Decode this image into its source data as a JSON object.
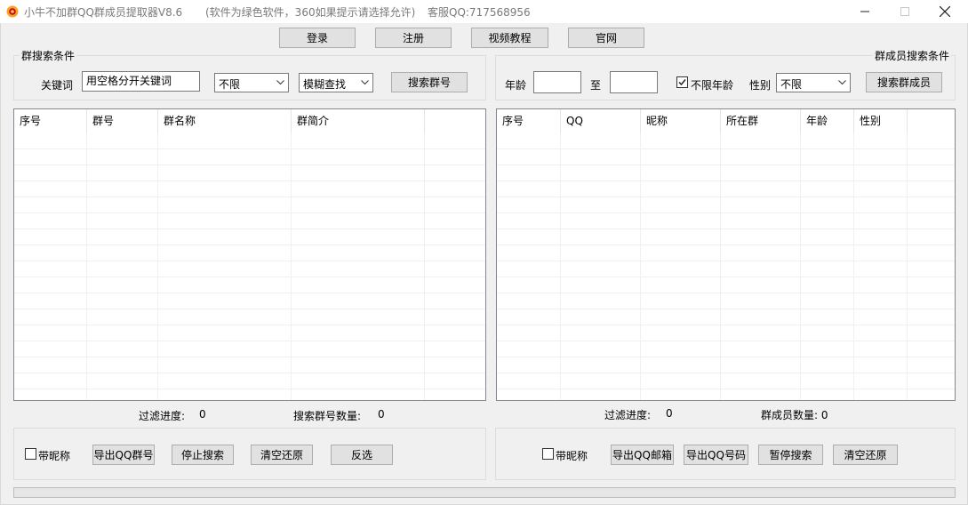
{
  "window": {
    "title": "小牛不加群QQ群成员提取器V8.6",
    "subtitle": "(软件为绿色软件，360如果提示请选择允许)",
    "service": "客服QQ:717568956"
  },
  "top_buttons": {
    "login": "登录",
    "register": "注册",
    "video": "视频教程",
    "website": "官网"
  },
  "group_search": {
    "title": "群搜索条件",
    "keyword_label": "关键词",
    "keyword_value": "用空格分开关键词",
    "filter_select": "不限",
    "match_select": "模糊查找",
    "search_button": "搜索群号"
  },
  "member_search": {
    "title": "群成员搜索条件",
    "age_label": "年龄",
    "age_from": "",
    "to_label": "至",
    "age_to": "",
    "unlimited_age_label": "不限年龄",
    "unlimited_age_checked": true,
    "gender_label": "性别",
    "gender_select": "不限",
    "search_button": "搜索群成员"
  },
  "group_table": {
    "columns": [
      "序号",
      "群号",
      "群名称",
      "群简介"
    ],
    "rows": []
  },
  "member_table": {
    "columns": [
      "序号",
      "QQ",
      "昵称",
      "所在群",
      "年龄",
      "性别"
    ],
    "rows": []
  },
  "group_status": {
    "progress_label": "过滤进度:",
    "progress_value": "0",
    "count_label": "搜索群号数量:",
    "count_value": "0"
  },
  "member_status": {
    "progress_label": "过滤进度:",
    "progress_value": "0",
    "count_text": "群成员数量: 0"
  },
  "group_actions": {
    "with_nickname": "带昵称",
    "with_nickname_checked": false,
    "export": "导出QQ群号",
    "stop": "停止搜索",
    "clear": "清空还原",
    "invert": "反选"
  },
  "member_actions": {
    "with_nickname": "带昵称",
    "with_nickname_checked": false,
    "export_email": "导出QQ邮箱",
    "export_qq": "导出QQ号码",
    "pause": "暂停搜索",
    "clear": "清空还原"
  },
  "bottom_progress": 0
}
